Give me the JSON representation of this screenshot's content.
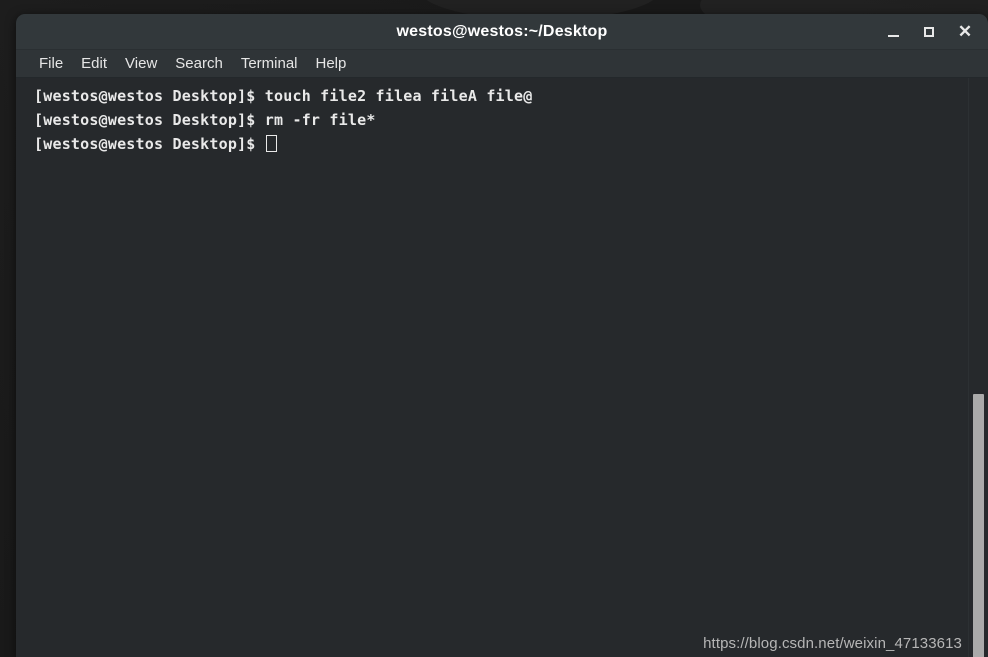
{
  "window": {
    "title": "westos@westos:~/Desktop",
    "controls": {
      "minimize_label": "_",
      "maximize_label": "□",
      "close_label": "✕"
    }
  },
  "menubar": {
    "items": [
      {
        "label": "File"
      },
      {
        "label": "Edit"
      },
      {
        "label": "View"
      },
      {
        "label": "Search"
      },
      {
        "label": "Terminal"
      },
      {
        "label": "Help"
      }
    ]
  },
  "terminal": {
    "prompt": "[westos@westos Desktop]$ ",
    "lines": [
      {
        "prompt": "[westos@westos Desktop]$ ",
        "command": "touch file2 filea fileA file@"
      },
      {
        "prompt": "[westos@westos Desktop]$ ",
        "command": "rm -fr file*"
      },
      {
        "prompt": "[westos@westos Desktop]$ ",
        "command": ""
      }
    ],
    "foreground_color": "#e9e9e9",
    "background_color": "#26292c"
  },
  "watermark": {
    "text": "https://blog.csdn.net/weixin_47133613"
  }
}
